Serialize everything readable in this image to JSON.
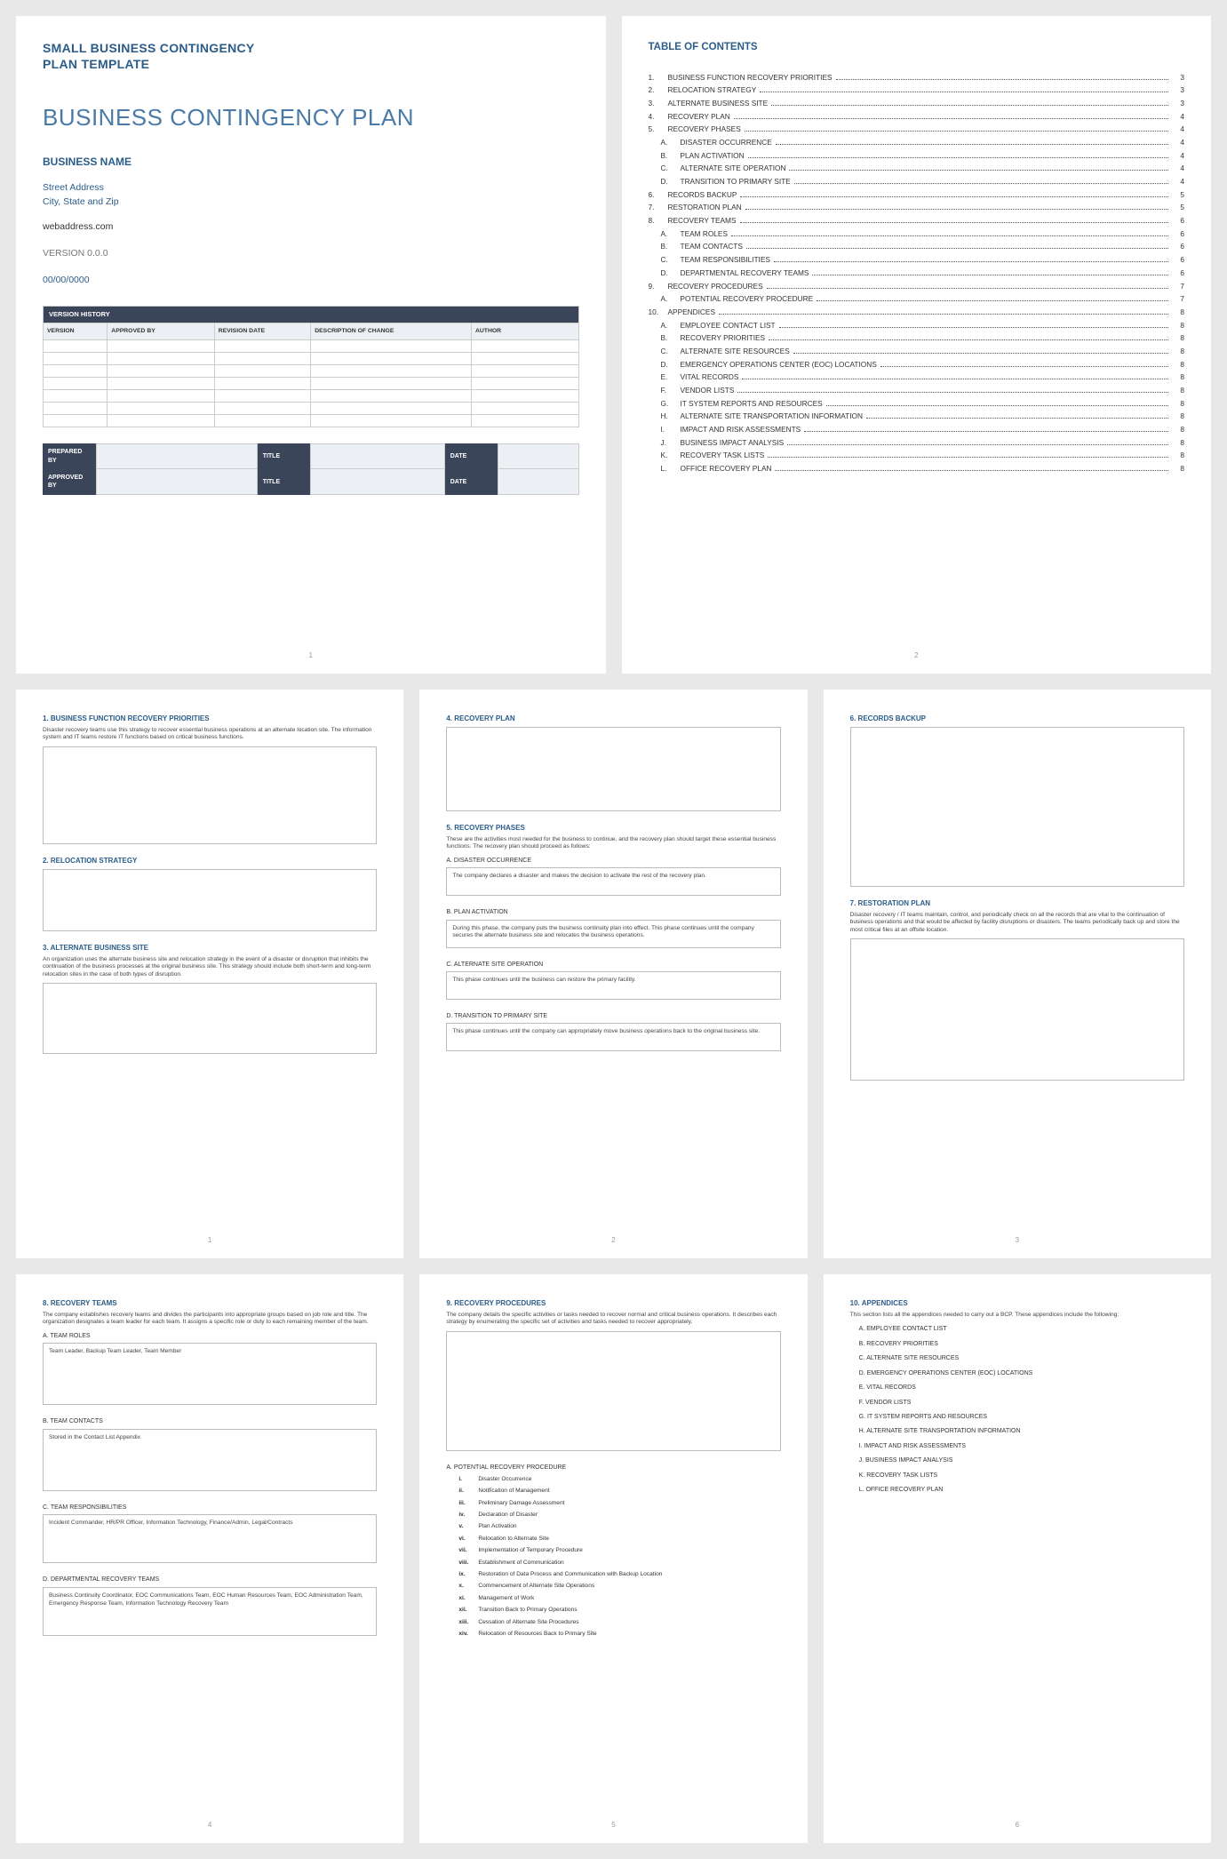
{
  "page1": {
    "subtitle1": "SMALL BUSINESS CONTINGENCY",
    "subtitle2": "PLAN TEMPLATE",
    "title": "BUSINESS CONTINGENCY PLAN",
    "businessName": "BUSINESS NAME",
    "street": "Street Address",
    "cityStateZip": "City, State and Zip",
    "web": "webaddress.com",
    "version": "VERSION 0.0.0",
    "date": "00/00/0000",
    "histCaption": "VERSION HISTORY",
    "histCols": [
      "VERSION",
      "APPROVED BY",
      "REVISION DATE",
      "DESCRIPTION OF CHANGE",
      "AUTHOR"
    ],
    "sig": {
      "preparedBy": "PREPARED BY",
      "approvedBy": "APPROVED BY",
      "title": "TITLE",
      "date": "DATE"
    },
    "pageNum": "1"
  },
  "page2": {
    "heading": "TABLE OF CONTENTS",
    "items": [
      {
        "n": "1.",
        "t": "BUSINESS FUNCTION RECOVERY PRIORITIES",
        "p": "3"
      },
      {
        "n": "2.",
        "t": "RELOCATION STRATEGY",
        "p": "3"
      },
      {
        "n": "3.",
        "t": "ALTERNATE BUSINESS SITE",
        "p": "3"
      },
      {
        "n": "4.",
        "t": "RECOVERY PLAN",
        "p": "4"
      },
      {
        "n": "5.",
        "t": "RECOVERY PHASES",
        "p": "4"
      },
      {
        "n": "A.",
        "t": "DISASTER OCCURRENCE",
        "p": "4",
        "sub": true
      },
      {
        "n": "B.",
        "t": "PLAN ACTIVATION",
        "p": "4",
        "sub": true
      },
      {
        "n": "C.",
        "t": "ALTERNATE SITE OPERATION",
        "p": "4",
        "sub": true
      },
      {
        "n": "D.",
        "t": "TRANSITION TO PRIMARY SITE",
        "p": "4",
        "sub": true
      },
      {
        "n": "6.",
        "t": "RECORDS BACKUP",
        "p": "5"
      },
      {
        "n": "7.",
        "t": "RESTORATION PLAN",
        "p": "5"
      },
      {
        "n": "8.",
        "t": "RECOVERY TEAMS",
        "p": "6"
      },
      {
        "n": "A.",
        "t": "TEAM ROLES",
        "p": "6",
        "sub": true
      },
      {
        "n": "B.",
        "t": "TEAM CONTACTS",
        "p": "6",
        "sub": true
      },
      {
        "n": "C.",
        "t": "TEAM RESPONSIBILITIES",
        "p": "6",
        "sub": true
      },
      {
        "n": "D.",
        "t": "DEPARTMENTAL RECOVERY TEAMS",
        "p": "6",
        "sub": true
      },
      {
        "n": "9.",
        "t": "RECOVERY PROCEDURES",
        "p": "7"
      },
      {
        "n": "A.",
        "t": "POTENTIAL RECOVERY PROCEDURE",
        "p": "7",
        "sub": true
      },
      {
        "n": "10.",
        "t": "APPENDICES",
        "p": "8"
      },
      {
        "n": "A.",
        "t": "EMPLOYEE CONTACT LIST",
        "p": "8",
        "sub": true
      },
      {
        "n": "B.",
        "t": "RECOVERY PRIORITIES",
        "p": "8",
        "sub": true
      },
      {
        "n": "C.",
        "t": "ALTERNATE SITE RESOURCES",
        "p": "8",
        "sub": true
      },
      {
        "n": "D.",
        "t": "EMERGENCY OPERATIONS CENTER (EOC) LOCATIONS",
        "p": "8",
        "sub": true
      },
      {
        "n": "E.",
        "t": "VITAL RECORDS",
        "p": "8",
        "sub": true
      },
      {
        "n": "F.",
        "t": "VENDOR LISTS",
        "p": "8",
        "sub": true
      },
      {
        "n": "G.",
        "t": "IT SYSTEM REPORTS AND RESOURCES",
        "p": "8",
        "sub": true
      },
      {
        "n": "H.",
        "t": "ALTERNATE SITE TRANSPORTATION INFORMATION",
        "p": "8",
        "sub": true
      },
      {
        "n": "I.",
        "t": "IMPACT AND RISK ASSESSMENTS",
        "p": "8",
        "sub": true
      },
      {
        "n": "J.",
        "t": "BUSINESS IMPACT ANALYSIS",
        "p": "8",
        "sub": true
      },
      {
        "n": "K.",
        "t": "RECOVERY TASK LISTS",
        "p": "8",
        "sub": true
      },
      {
        "n": "L.",
        "t": "OFFICE RECOVERY PLAN",
        "p": "8",
        "sub": true
      }
    ],
    "pageNum": "2"
  },
  "page3": {
    "s1h": "1. BUSINESS FUNCTION RECOVERY PRIORITIES",
    "s1d": "Disaster recovery teams use this strategy to recover essential business operations at an alternate location site. The information system and IT teams restore IT functions based on critical business functions.",
    "s2h": "2. RELOCATION STRATEGY",
    "s3h": "3. ALTERNATE BUSINESS SITE",
    "s3d": "An organization uses the alternate business site and relocation strategy in the event of a disaster or disruption that inhibits the continuation of the business processes at the original business site. This strategy should include both short-term and long-term relocation sites in the case of both types of disruption.",
    "pageNum": "1"
  },
  "page4": {
    "s4h": "4. RECOVERY PLAN",
    "s5h": "5. RECOVERY PHASES",
    "s5d": "These are the activities most needed for the business to continue, and the recovery plan should target these essential business functions. The recovery plan should proceed as follows:",
    "aH": "A.  DISASTER OCCURRENCE",
    "aT": "The company declares a disaster and makes the decision to activate the rest of the recovery plan.",
    "bH": "B.  PLAN ACTIVATION",
    "bT": "During this phase, the company puts the business continuity plan into effect. This phase continues until the company secures the alternate business site and relocates the business operations.",
    "cH": "C.  ALTERNATE SITE OPERATION",
    "cT": "This phase continues until the business can restore the primary facility.",
    "dH": "D.  TRANSITION TO PRIMARY SITE",
    "dT": "This phase continues until the company can appropriately move business operations back to the original business site.",
    "pageNum": "2"
  },
  "page5": {
    "s6h": "6. RECORDS BACKUP",
    "s7h": "7. RESTORATION PLAN",
    "s7d": "Disaster recovery / IT teams maintain, control, and periodically check on all the records that are vital to the continuation of business operations and that would be affected by facility disruptions or disasters. The teams periodically back up and store the most critical files at an offsite location.",
    "pageNum": "3"
  },
  "page6": {
    "s8h": "8. RECOVERY TEAMS",
    "s8d": "The company establishes recovery teams and divides the participants into appropriate groups based on job role and title. The organization designates a team leader for each team. It assigns a specific role or duty to each remaining member of the team.",
    "aH": "A.  TEAM ROLES",
    "aT": "Team Leader, Backup Team Leader, Team Member",
    "bH": "B.  TEAM CONTACTS",
    "bT": "Stored in the Contact List Appendix",
    "cH": "C.  TEAM RESPONSIBILITIES",
    "cT": "Incident Commander, HR/PR Officer, Information Technology, Finance/Admin, Legal/Contracts",
    "dH": "D.  DEPARTMENTAL RECOVERY TEAMS",
    "dT": "Business Continuity Coordinator, EOC Communications Team, EOC Human Resources Team, EOC Administration Team, Emergency Response Team, Information Technology Recovery Team",
    "pageNum": "4"
  },
  "page7": {
    "s9h": "9. RECOVERY PROCEDURES",
    "s9d": "The company details the specific activities or tasks needed to recover normal and critical business operations. It describes each strategy by enumerating the specific set of activities and tasks needed to recover appropriately.",
    "aH": "A.  POTENTIAL RECOVERY PROCEDURE",
    "steps": [
      {
        "n": "i.",
        "t": "Disaster Occurrence"
      },
      {
        "n": "ii.",
        "t": "Notification of Management"
      },
      {
        "n": "iii.",
        "t": "Preliminary Damage Assessment"
      },
      {
        "n": "iv.",
        "t": "Declaration of Disaster"
      },
      {
        "n": "v.",
        "t": "Plan Activation"
      },
      {
        "n": "vi.",
        "t": "Relocation to Alternate Site"
      },
      {
        "n": "vii.",
        "t": "Implementation of Temporary Procedure"
      },
      {
        "n": "viii.",
        "t": "Establishment of Communication"
      },
      {
        "n": "ix.",
        "t": "Restoration of Data Process and Communication with Backup Location"
      },
      {
        "n": "x.",
        "t": "Commencement of Alternate Site Operations"
      },
      {
        "n": "xi.",
        "t": "Management of Work"
      },
      {
        "n": "xii.",
        "t": "Transition Back to Primary Operations"
      },
      {
        "n": "xiii.",
        "t": "Cessation of Alternate Site Procedures"
      },
      {
        "n": "xiv.",
        "t": "Relocation of Resources Back to Primary Site"
      }
    ],
    "pageNum": "5"
  },
  "page8": {
    "s10h": "10.  APPENDICES",
    "s10d": "This section lists all the appendices needed to carry out a BCP. These appendices include the following:",
    "items": [
      "A.  EMPLOYEE CONTACT LIST",
      "B.  RECOVERY PRIORITIES",
      "C.  ALTERNATE SITE RESOURCES",
      "D.  EMERGENCY OPERATIONS CENTER (EOC) LOCATIONS",
      "E.  VITAL RECORDS",
      "F.  VENDOR LISTS",
      "G.  IT SYSTEM REPORTS AND RESOURCES",
      "H.  ALTERNATE SITE TRANSPORTATION INFORMATION",
      "I.   IMPACT AND RISK ASSESSMENTS",
      "J.  BUSINESS IMPACT ANALYSIS",
      "K.  RECOVERY TASK LISTS",
      "L.  OFFICE RECOVERY PLAN"
    ],
    "pageNum": "6"
  }
}
